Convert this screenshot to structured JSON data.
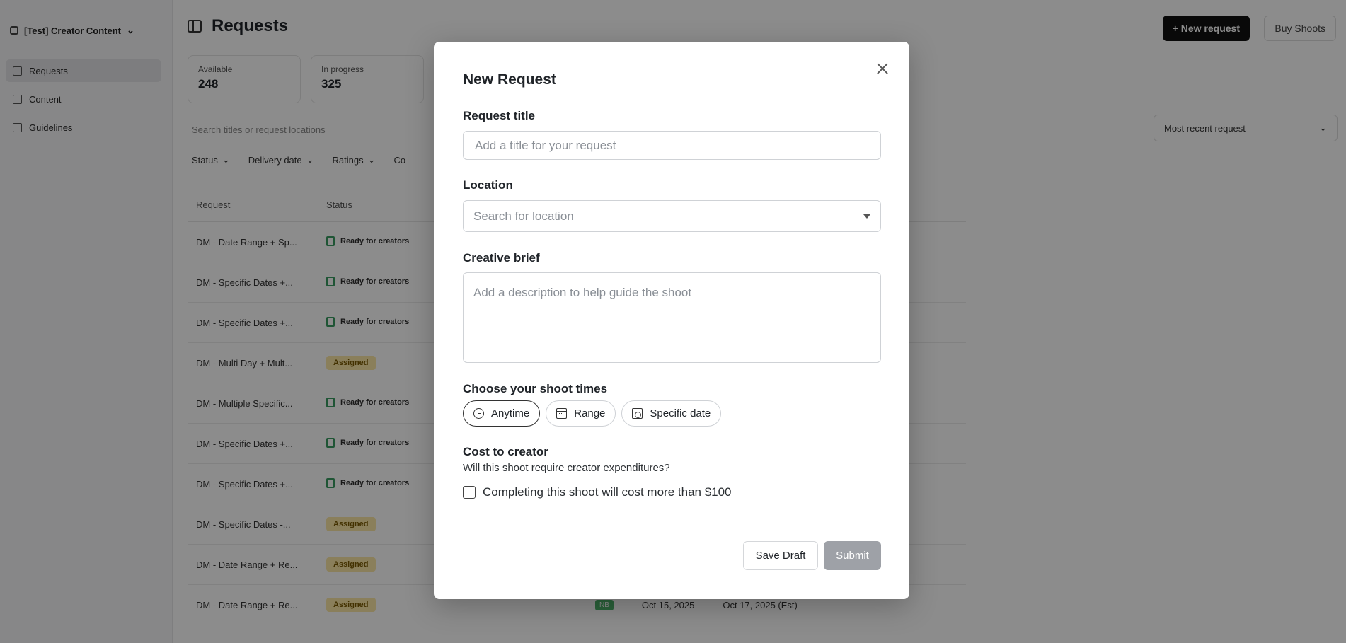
{
  "app": {
    "workspace": "[Test] Creator Content",
    "nav": [
      {
        "label": "Requests",
        "icon": "list-icon"
      },
      {
        "label": "Content",
        "icon": "content-icon"
      },
      {
        "label": "Guidelines",
        "icon": "guidelines-icon"
      }
    ],
    "page_title": "Requests",
    "new_request_label": "+ New request",
    "buy_shoots_label": "Buy Shoots",
    "stats": [
      {
        "label": "Available",
        "value": "248"
      },
      {
        "label": "In progress",
        "value": "325"
      }
    ],
    "search_placeholder": "Search titles or request locations",
    "sort_label": "Most recent request",
    "filters": [
      "Status",
      "Delivery date",
      "Ratings",
      "Co"
    ],
    "table": {
      "headers": [
        "Request",
        "Status"
      ],
      "rows": [
        {
          "title": "DM - Date Range + Sp...",
          "status": "Ready for creators",
          "status_type": "ready"
        },
        {
          "title": "DM - Specific Dates +...",
          "status": "Ready for creators",
          "status_type": "ready"
        },
        {
          "title": "DM - Specific Dates +...",
          "status": "Ready for creators",
          "status_type": "ready"
        },
        {
          "title": "DM - Multi Day + Mult...",
          "status": "Assigned",
          "status_type": "assigned"
        },
        {
          "title": "DM - Multiple Specific...",
          "status": "Ready for creators",
          "status_type": "ready"
        },
        {
          "title": "DM - Specific Dates +...",
          "status": "Ready for creators",
          "status_type": "ready"
        },
        {
          "title": "DM - Specific Dates +...",
          "status": "Ready for creators",
          "status_type": "ready"
        },
        {
          "title": "DM - Specific Dates -...",
          "status": "Assigned",
          "status_type": "assigned"
        },
        {
          "title": "DM - Date Range + Re...",
          "status": "Assigned",
          "status_type": "assigned"
        },
        {
          "title": "DM - Date Range + Re...",
          "status": "Assigned",
          "status_type": "assigned"
        }
      ],
      "last_row_extra": {
        "tag": "NB",
        "date1": "Oct 15, 2025",
        "date2": "Oct 17, 2025 (Est)"
      }
    }
  },
  "modal": {
    "title": "New Request",
    "request_title_label": "Request title",
    "request_title_placeholder": "Add a title for your request",
    "location_label": "Location",
    "location_placeholder": "Search for location",
    "brief_label": "Creative brief",
    "brief_placeholder": "Add a description to help guide the shoot",
    "shoot_times_label": "Choose your shoot times",
    "shoot_time_options": [
      {
        "label": "Anytime",
        "icon": "clock-icon",
        "selected": true
      },
      {
        "label": "Range",
        "icon": "calendar-icon",
        "selected": false
      },
      {
        "label": "Specific date",
        "icon": "calendar-clock-icon",
        "selected": false
      }
    ],
    "cost_label": "Cost to creator",
    "cost_sublabel": "Will this shoot require creator expenditures?",
    "cost_checkbox_label": "Completing this shoot will cost more than $100",
    "cost_checkbox_checked": false,
    "save_draft_label": "Save Draft",
    "submit_label": "Submit"
  },
  "colors": {
    "overlay": "rgba(0,0,0,0.45)",
    "submit_disabled": "#9ea1a7",
    "assigned_badge": "#fbe7a6",
    "ready_icon": "#3a9c62"
  }
}
